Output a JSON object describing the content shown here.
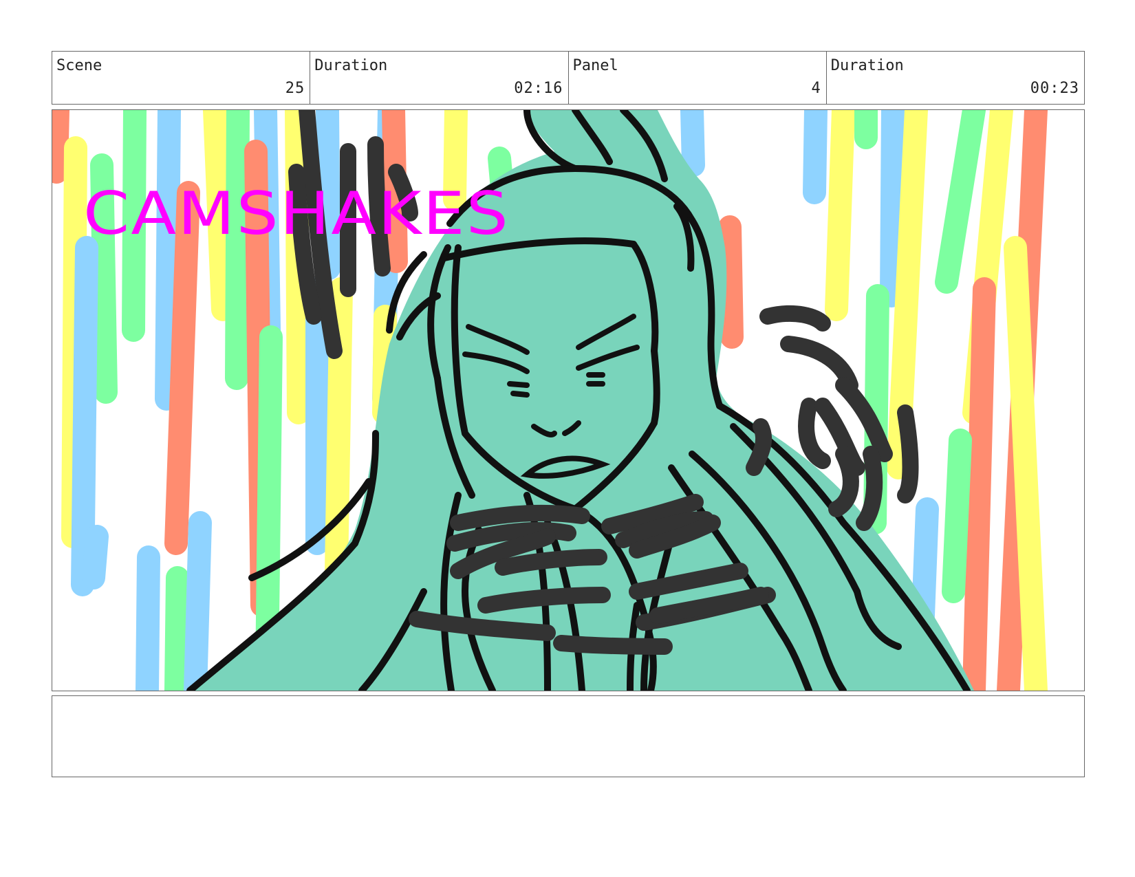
{
  "header": {
    "scene_label": "Scene",
    "scene_value": "25",
    "scene_duration_label": "Duration",
    "scene_duration_value": "02:16",
    "panel_label": "Panel",
    "panel_value": "4",
    "panel_duration_label": "Duration",
    "panel_duration_value": "00:23"
  },
  "panel": {
    "annotation": "CAMSHAKES",
    "annotation_color": "#ff00ff",
    "skin_color": "#79d4bb",
    "ink_color": "#111111",
    "shake_mark_color": "#333333",
    "stripe_colors": [
      "#ff8c70",
      "#ffff70",
      "#7dffa0",
      "#8fd3ff"
    ]
  },
  "notes": {
    "text": ""
  }
}
